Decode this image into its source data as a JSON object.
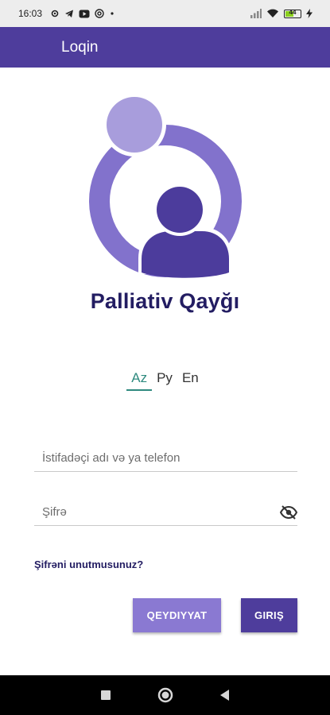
{
  "status_bar": {
    "time": "16:03",
    "battery_level": "44",
    "left_icons": [
      "settings-icon",
      "telegram-icon",
      "youtube-icon",
      "at-icon",
      "dot-icon"
    ],
    "right_icons": [
      "signal-icon",
      "wifi-icon",
      "battery-icon",
      "charging-icon"
    ]
  },
  "app_bar": {
    "title": "Loqin"
  },
  "brand": {
    "name": "Palliativ Qayğı",
    "color": "#231d62"
  },
  "languages": {
    "items": [
      {
        "label": "Az",
        "active": true
      },
      {
        "label": "Ру",
        "active": false
      },
      {
        "label": "En",
        "active": false
      }
    ],
    "active_color": "#2f8a7f"
  },
  "form": {
    "username_placeholder": "İstifadəçi adı və ya telefon",
    "username_value": "",
    "password_placeholder": "Şifrə",
    "password_value": "",
    "forgot_label": "Şifrəni unutmusunuz?"
  },
  "buttons": {
    "register_label": "QEYDIYYAT",
    "login_label": "GIRIŞ"
  },
  "colors": {
    "primary": "#4e3d9c",
    "secondary": "#8a79d2",
    "logo_light": "#a89ddc",
    "logo_mid": "#8272cc",
    "logo_dark": "#4c3c9c"
  },
  "nav_bar": {
    "icons": [
      "recent-apps-icon",
      "home-icon",
      "back-icon"
    ]
  }
}
